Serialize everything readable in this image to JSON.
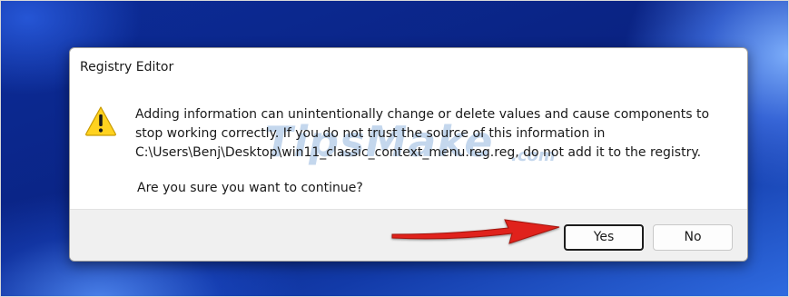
{
  "dialog": {
    "title": "Registry Editor",
    "icon": "warning-icon",
    "message": "Adding information can unintentionally change or delete values and cause components to stop working correctly. If you do not trust the source of this information in C:\\Users\\Benj\\Desktop\\win11_classic_context_menu.reg.reg, do not add it to the registry.",
    "question": "Are you sure you want to continue?",
    "yes_label": "Yes",
    "no_label": "No"
  },
  "watermark": {
    "text": "TipsMake",
    "suffix": ".com"
  },
  "annotation": {
    "arrow_color": "#e0241b",
    "points_to": "yes-button"
  },
  "colors": {
    "desktop_blue": "#0a2a8f",
    "dialog_bg": "#ffffff",
    "footer_bg": "#f0f0f0",
    "warning_yellow": "#ffd21f"
  }
}
